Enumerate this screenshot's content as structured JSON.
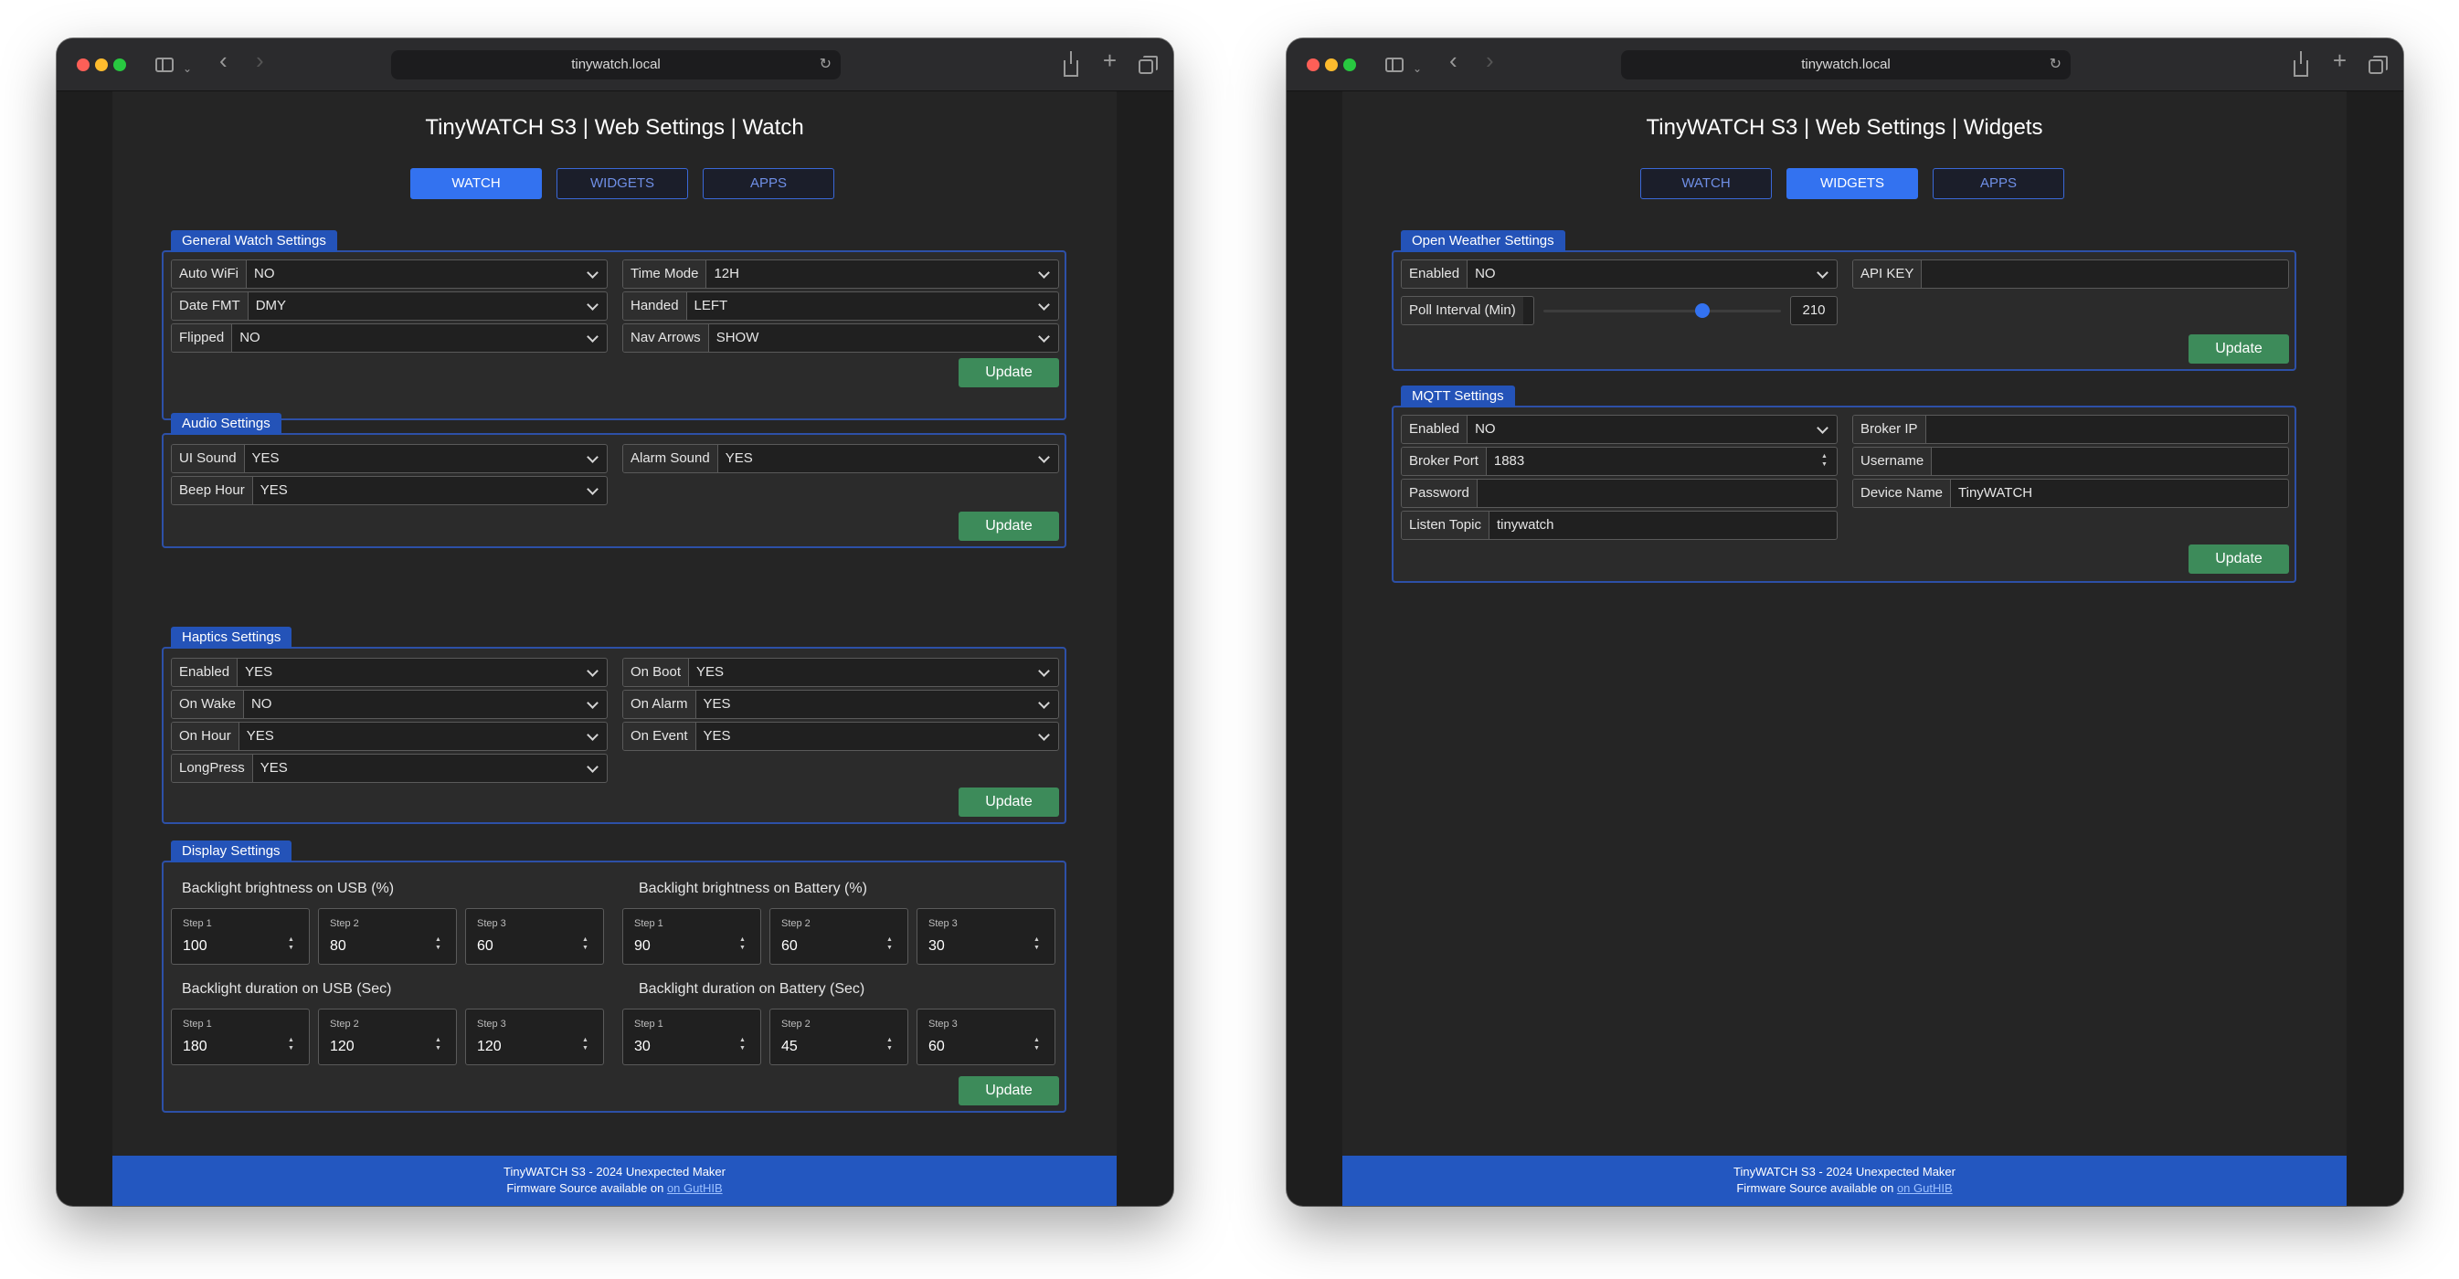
{
  "browser": {
    "url": "tinywatch.local"
  },
  "colors": {
    "accent": "#3372f0",
    "section": "#2453b8",
    "update": "#3d8b5a",
    "footer": "#2357c0"
  },
  "icons": {
    "sidebar": "sidebar-icon",
    "back": "chevron-left-icon",
    "forward": "chevron-right-icon",
    "reload": "reload-icon",
    "share": "share-icon",
    "newtab": "plus-icon",
    "tabs": "tabs-icon"
  },
  "nav": {
    "watch": "WATCH",
    "widgets": "WIDGETS",
    "apps": "APPS"
  },
  "update_label": "Update",
  "footer": {
    "line1": "TinyWATCH S3 - 2024 Unexpected Maker",
    "line2": "Firmware Source available on ",
    "link": "on GutHIB"
  },
  "watch_page": {
    "title": "TinyWATCH S3 | Web Settings | Watch",
    "general": {
      "label": "General Watch Settings",
      "auto_wifi": {
        "label": "Auto WiFi",
        "value": "NO"
      },
      "date_fmt": {
        "label": "Date FMT",
        "value": "DMY"
      },
      "flipped": {
        "label": "Flipped",
        "value": "NO"
      },
      "time_mode": {
        "label": "Time Mode",
        "value": "12H"
      },
      "handed": {
        "label": "Handed",
        "value": "LEFT"
      },
      "nav_arrows": {
        "label": "Nav Arrows",
        "value": "SHOW"
      }
    },
    "audio": {
      "label": "Audio Settings",
      "ui_sound": {
        "label": "UI Sound",
        "value": "YES"
      },
      "beep_hour": {
        "label": "Beep Hour",
        "value": "YES"
      },
      "alarm_sound": {
        "label": "Alarm Sound",
        "value": "YES"
      }
    },
    "haptics": {
      "label": "Haptics Settings",
      "enabled": {
        "label": "Enabled",
        "value": "YES"
      },
      "on_wake": {
        "label": "On Wake",
        "value": "NO"
      },
      "on_hour": {
        "label": "On Hour",
        "value": "YES"
      },
      "longpress": {
        "label": "LongPress",
        "value": "YES"
      },
      "on_boot": {
        "label": "On Boot",
        "value": "YES"
      },
      "on_alarm": {
        "label": "On Alarm",
        "value": "YES"
      },
      "on_event": {
        "label": "On Event",
        "value": "YES"
      }
    },
    "display": {
      "label": "Display Settings",
      "step1": "Step 1",
      "step2": "Step 2",
      "step3": "Step 3",
      "bright_usb": {
        "title": "Backlight brightness on USB (%)",
        "s1": "100",
        "s2": "80",
        "s3": "60"
      },
      "bright_batt": {
        "title": "Backlight brightness on Battery (%)",
        "s1": "90",
        "s2": "60",
        "s3": "30"
      },
      "dur_usb": {
        "title": "Backlight duration on USB (Sec)",
        "s1": "180",
        "s2": "120",
        "s3": "120"
      },
      "dur_batt": {
        "title": "Backlight duration on Battery (Sec)",
        "s1": "30",
        "s2": "45",
        "s3": "60"
      }
    }
  },
  "widgets_page": {
    "title": "TinyWATCH S3 | Web Settings | Widgets",
    "weather": {
      "label": "Open Weather Settings",
      "enabled": {
        "label": "Enabled",
        "value": "NO"
      },
      "api_key": {
        "label": "API KEY",
        "value": ""
      },
      "poll": {
        "label": "Poll Interval (Min)",
        "value": "210",
        "fraction": 0.67
      }
    },
    "mqtt": {
      "label": "MQTT Settings",
      "enabled": {
        "label": "Enabled",
        "value": "NO"
      },
      "broker_port": {
        "label": "Broker Port",
        "value": "1883"
      },
      "password": {
        "label": "Password",
        "value": ""
      },
      "listen_topic": {
        "label": "Listen Topic",
        "value": "tinywatch"
      },
      "broker_ip": {
        "label": "Broker IP",
        "value": ""
      },
      "username": {
        "label": "Username",
        "value": ""
      },
      "device_name": {
        "label": "Device Name",
        "value": "TinyWATCH"
      }
    }
  }
}
